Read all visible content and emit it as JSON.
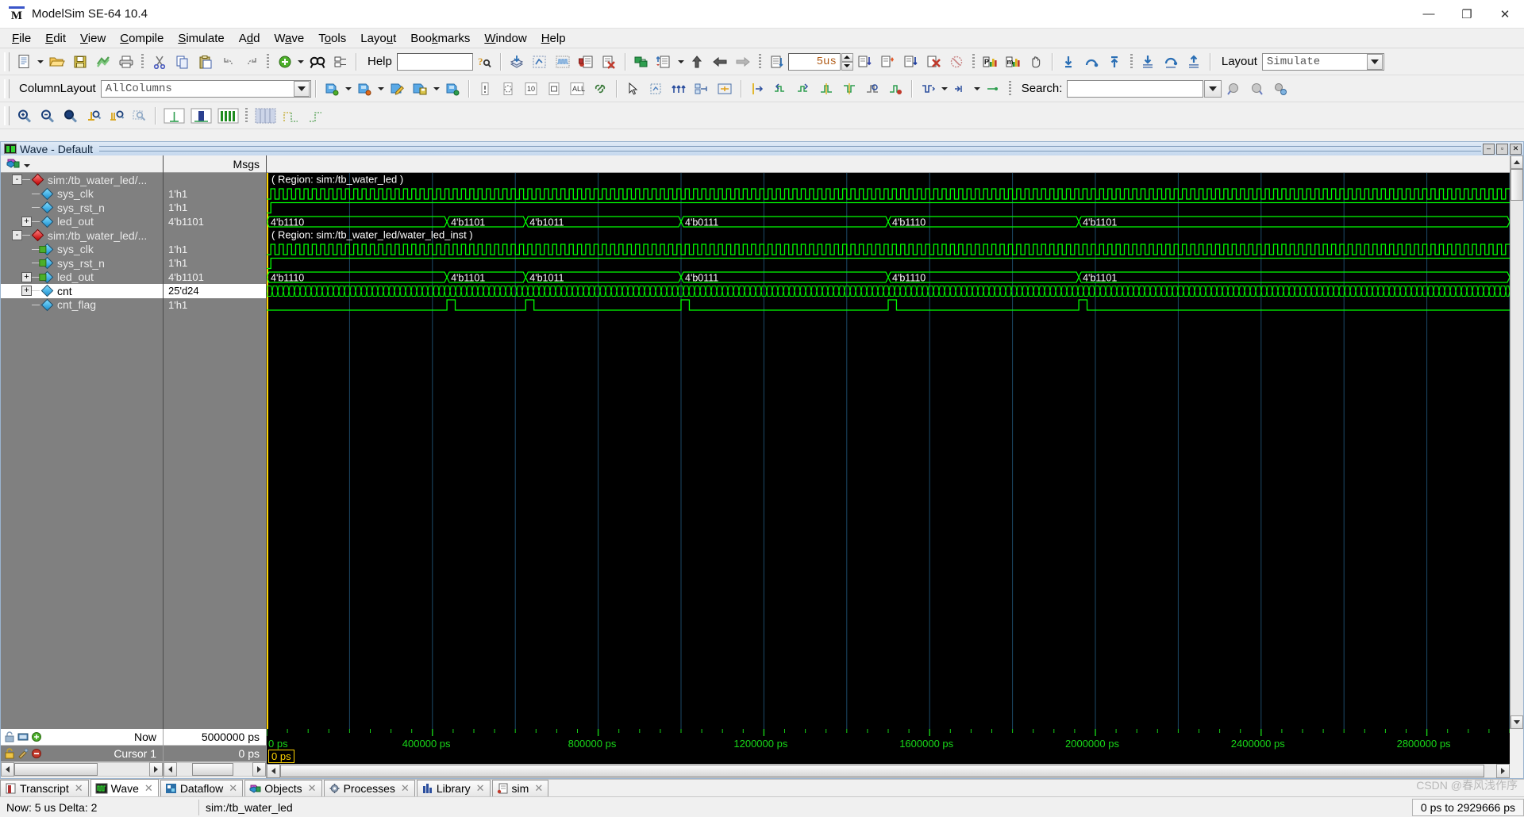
{
  "window": {
    "title": "ModelSim SE-64 10.4",
    "logo_letter": "M",
    "minimize": "—",
    "maximize": "❐",
    "close": "✕"
  },
  "menubar": {
    "items": [
      {
        "label": "File",
        "accel": "F"
      },
      {
        "label": "Edit",
        "accel": "E"
      },
      {
        "label": "View",
        "accel": "V"
      },
      {
        "label": "Compile",
        "accel": "C"
      },
      {
        "label": "Simulate",
        "accel": "S"
      },
      {
        "label": "Add",
        "accel": "d"
      },
      {
        "label": "Wave",
        "accel": "a"
      },
      {
        "label": "Tools",
        "accel": "o"
      },
      {
        "label": "Layout",
        "accel": "u"
      },
      {
        "label": "Bookmarks",
        "accel": "k"
      },
      {
        "label": "Window",
        "accel": "W"
      },
      {
        "label": "Help",
        "accel": "H"
      }
    ]
  },
  "toolbar1": {
    "help_label": "Help",
    "help_value": "",
    "help_placeholder": "",
    "run_length_value": "5us",
    "layout_label": "Layout",
    "layout_value": "Simulate",
    "icons": [
      "new-file-icon",
      "open-folder-icon",
      "save-icon",
      "compile-icon",
      "print-icon",
      "cut-icon",
      "copy-icon",
      "paste-icon",
      "undo-icon",
      "redo-icon",
      "add-object-icon",
      "find-icon",
      "properties-icon",
      "help-context-icon",
      "simulate-icon",
      "dataflow-icon",
      "wave-icon",
      "coverage-icon",
      "delete-icon",
      "compile-all-icon",
      "step-list-icon",
      "up-arrow-icon",
      "back-arrow-icon",
      "forward-arrow-icon",
      "run-icon",
      "run-continue-icon",
      "run-break-icon",
      "run-restart-icon",
      "stop-icon",
      "break-icon",
      "profile-icon",
      "memory-icon",
      "hand-icon",
      "step-into-icon",
      "step-over-icon",
      "step-out-icon",
      "step-into-all-icon",
      "step-over-all-icon",
      "step-out-all-icon"
    ]
  },
  "toolbar2": {
    "columnlayout_label": "ColumnLayout",
    "columnlayout_value": "AllColumns",
    "search_label": "Search:",
    "search_value": "",
    "search_placeholder": "",
    "icons": [
      "bookmark-add-icon",
      "bookmark-remove-icon",
      "bookmark-edit-icon",
      "bookmark-save-icon",
      "bookmark-goto-icon",
      "cursor-icon",
      "circle-icon",
      "radix-icon",
      "format-icon",
      "all-columns-icon",
      "link-icon",
      "select-mode-icon",
      "zoom-mode-icon",
      "compare-icon",
      "group-icon",
      "expand-icon",
      "insert-cursor-icon",
      "prev-transition-icon",
      "next-transition-icon",
      "prev-edge-icon",
      "next-edge-icon",
      "find-edge-icon",
      "mark-icon",
      "wave-compare-icon",
      "wave-expand-icon",
      "bookmark-list-icon",
      "search-next-icon",
      "search-prev-icon",
      "search-options-icon"
    ]
  },
  "toolbar3": {
    "icons": [
      "zoom-in-icon",
      "zoom-out-icon",
      "zoom-full-icon",
      "zoom-cursor-icon",
      "zoom-range-icon",
      "zoom-select-icon",
      "wave-view-1-icon",
      "wave-view-2-icon",
      "wave-view-3-icon",
      "grid-icon",
      "grid-step-icon",
      "grid-offset-icon"
    ]
  },
  "wave_window": {
    "title": "Wave - Default",
    "minimize": "–",
    "maximize": "▫",
    "close": "✕",
    "names_header_icon": "wave-props-icon",
    "values_header": "Msgs",
    "signals": [
      {
        "name": "sim:/tb_water_led/...",
        "value": "",
        "depth": 0,
        "icon": "region-diamond-red",
        "expander": "-",
        "selected": false
      },
      {
        "name": "sys_clk",
        "value": "1'h1",
        "depth": 1,
        "icon": "signal-diamond-blue",
        "expander": "",
        "selected": false
      },
      {
        "name": "sys_rst_n",
        "value": "1'h1",
        "depth": 1,
        "icon": "signal-diamond-blue",
        "expander": "",
        "selected": false
      },
      {
        "name": "led_out",
        "value": "4'b1101",
        "depth": 1,
        "icon": "signal-diamond-blue",
        "expander": "+",
        "selected": false
      },
      {
        "name": "sim:/tb_water_led/...",
        "value": "",
        "depth": 0,
        "icon": "region-diamond-red",
        "expander": "-",
        "selected": false
      },
      {
        "name": "sys_clk",
        "value": "1'h1",
        "depth": 1,
        "icon": "signal-diamond-green",
        "expander": "",
        "selected": false
      },
      {
        "name": "sys_rst_n",
        "value": "1'h1",
        "depth": 1,
        "icon": "signal-diamond-green",
        "expander": "",
        "selected": false
      },
      {
        "name": "led_out",
        "value": "4'b1101",
        "depth": 1,
        "icon": "signal-diamond-green",
        "expander": "+",
        "selected": false
      },
      {
        "name": "cnt",
        "value": "25'd24",
        "depth": 1,
        "icon": "signal-diamond-blue",
        "expander": "+",
        "selected": true
      },
      {
        "name": "cnt_flag",
        "value": "1'h1",
        "depth": 1,
        "icon": "signal-diamond-blue",
        "expander": "",
        "selected": false
      }
    ],
    "cursor_rows": [
      {
        "label": "Now",
        "value": "5000000 ps",
        "style": "white",
        "icons": [
          "lock-now-icon",
          "goto-now-icon",
          "add-cursor-icon"
        ]
      },
      {
        "label": "Cursor 1",
        "value": "0 ps",
        "style": "gray",
        "icons": [
          "lock-icon",
          "cursor-tool-icon",
          "remove-cursor-icon"
        ]
      }
    ],
    "cursor_marker_label": "0 ps"
  },
  "chart_data": {
    "type": "line",
    "title": "Wave - Default",
    "xlabel": "",
    "ylabel": "",
    "xlim": [
      0,
      3000000
    ],
    "x_unit": "ps",
    "grid": true,
    "tick_labels": [
      "0 ps",
      "400000 ps",
      "800000 ps",
      "1200000 ps",
      "1600000 ps",
      "2000000 ps",
      "2400000 ps",
      "2800000 ps"
    ],
    "tick_values": [
      0,
      400000,
      800000,
      1200000,
      1600000,
      2000000,
      2400000,
      2800000
    ],
    "row_labels": [
      "( Region: sim:/tb_water_led )",
      "sys_clk",
      "sys_rst_n",
      "led_out",
      "( Region: sim:/tb_water_led/water_led_inst )",
      "sys_clk",
      "sys_rst_n",
      "led_out",
      "cnt",
      "cnt_flag"
    ],
    "region_labels": [
      {
        "text": "( Region: sim:/tb_water_led )",
        "row": 0
      },
      {
        "text": "( Region: sim:/tb_water_led/water_led_inst )",
        "row": 4
      }
    ],
    "bus_transitions_top": [
      {
        "value": "4'b1110",
        "t": 0
      },
      {
        "value": "4'b1101",
        "t": 435000
      },
      {
        "value": "4'b1011",
        "t": 625000
      },
      {
        "value": "4'b0111",
        "t": 1000000
      },
      {
        "value": "4'b1110",
        "t": 1500000
      },
      {
        "value": "4'b1101",
        "t": 1960000
      }
    ],
    "bus_transitions_bottom": [
      {
        "value": "4'b1110",
        "t": 0
      },
      {
        "value": "4'b1101",
        "t": 435000
      },
      {
        "value": "4'b1011",
        "t": 625000
      },
      {
        "value": "4'b0111",
        "t": 1000000
      },
      {
        "value": "4'b1110",
        "t": 1500000
      },
      {
        "value": "4'b1101",
        "t": 1960000
      }
    ],
    "clock_period_ps": 20000,
    "reset_release_t": 10000,
    "cnt_flag_pulses": [
      435000,
      625000,
      1000000,
      1500000,
      1960000
    ],
    "cursor_time": 0,
    "now_time": 5000000,
    "waveform_color": "#00ff00",
    "grid_color": "#1d4a69",
    "background": "#000000"
  },
  "tabs": [
    {
      "label": "Transcript",
      "icon": "transcript-icon",
      "active": false,
      "close": "✕"
    },
    {
      "label": "Wave",
      "icon": "wave-tab-icon",
      "active": true,
      "close": "✕"
    },
    {
      "label": "Dataflow",
      "icon": "dataflow-tab-icon",
      "active": false,
      "close": "✕"
    },
    {
      "label": "Objects",
      "icon": "objects-tab-icon",
      "active": false,
      "close": "✕"
    },
    {
      "label": "Processes",
      "icon": "processes-tab-icon",
      "active": false,
      "close": "✕"
    },
    {
      "label": "Library",
      "icon": "library-tab-icon",
      "active": false,
      "close": "✕"
    },
    {
      "label": "sim",
      "icon": "sim-tab-icon",
      "active": false,
      "close": "✕"
    }
  ],
  "statusbar": {
    "now_delta": "Now: 5 us  Delta: 2",
    "context": "sim:/tb_water_led",
    "range": "0 ps to 2929666 ps"
  },
  "watermark": "CSDN @春风浅作序",
  "colors": {
    "accent_green": "#00ff00",
    "grid": "#1d4a69",
    "cursor_yellow": "#ffd400",
    "pane_gray": "#808080",
    "toolbar_bg": "#f0f0f0"
  }
}
